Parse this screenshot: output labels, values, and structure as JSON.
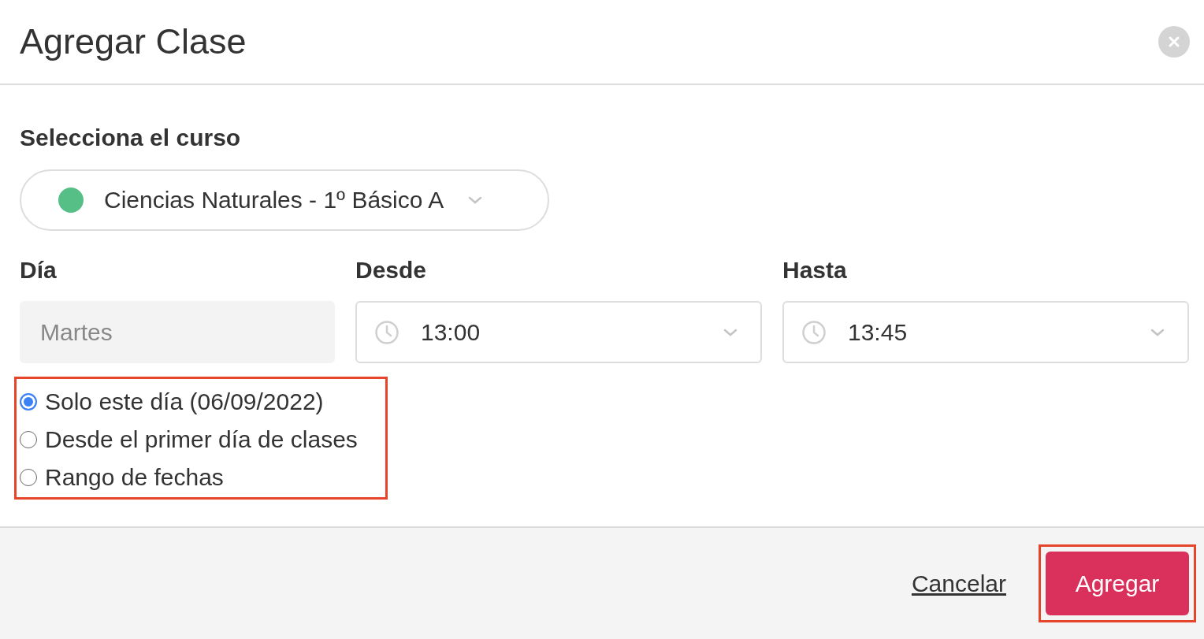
{
  "dialog": {
    "title": "Agregar Clase"
  },
  "course": {
    "label": "Selecciona el curso",
    "value": "Ciencias Naturales - 1º Básico A"
  },
  "fields": [
    {
      "kind": "text",
      "label": "Día",
      "value": "Martes",
      "disabled": true
    },
    {
      "kind": "time",
      "label": "Desde",
      "value": "13:00",
      "disabled": false
    },
    {
      "kind": "time",
      "label": "Hasta",
      "value": "13:45",
      "disabled": false
    }
  ],
  "options": {
    "highlighted": true,
    "items": [
      {
        "label": "Solo este día (06/09/2022)",
        "selected": true
      },
      {
        "label": "Desde el primer día de clases",
        "selected": false
      },
      {
        "label": "Rango de fechas",
        "selected": false
      }
    ]
  },
  "footer": {
    "cancel": "Cancelar",
    "submit": "Agregar",
    "submit_highlighted": true
  }
}
